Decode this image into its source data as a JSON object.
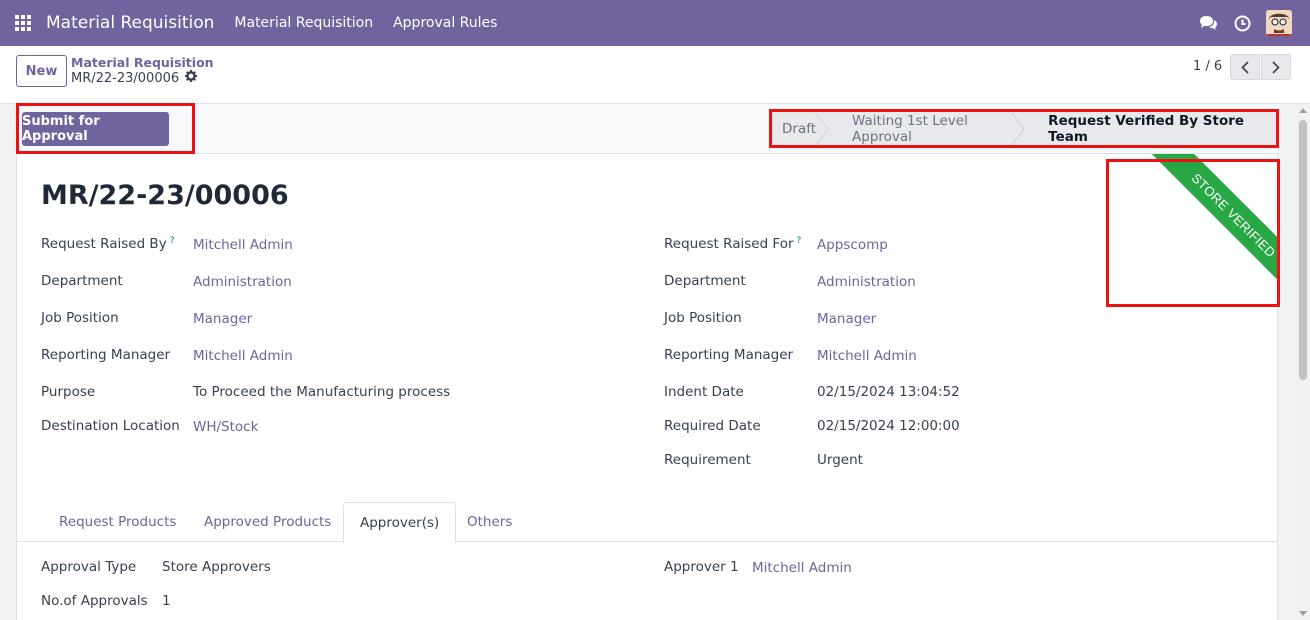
{
  "navbar": {
    "brand": "Material Requisition",
    "menu": [
      "Material Requisition",
      "Approval Rules"
    ]
  },
  "control": {
    "new_label": "New",
    "breadcrumb_parent": "Material Requisition",
    "breadcrumb_current": "MR/22-23/00006",
    "pager": "1 / 6"
  },
  "statusbar": {
    "submit_label": "Submit for Approval",
    "stages": [
      "Draft",
      "Waiting 1st Level Approval",
      "Request Verified By Store Team"
    ],
    "active_stage": "Request Verified By Store Team"
  },
  "ribbon": {
    "text": "STORE VERIFIED",
    "color": "#28a745"
  },
  "record": {
    "title": "MR/22-23/00006",
    "left": [
      {
        "label": "Request Raised By",
        "value": "Mitchell Admin",
        "help": "?"
      },
      {
        "label": "Department",
        "value": "Administration"
      },
      {
        "label": "Job Position",
        "value": "Manager"
      },
      {
        "label": "Reporting Manager",
        "value": "Mitchell Admin"
      },
      {
        "label": "Purpose",
        "value": "To Proceed the Manufacturing process"
      },
      {
        "label": "Destination Location",
        "value": "WH/Stock"
      }
    ],
    "right": [
      {
        "label": "Request Raised For",
        "value": "Appscomp",
        "help": "?"
      },
      {
        "label": "Department",
        "value": "Administration"
      },
      {
        "label": "Job Position",
        "value": "Manager"
      },
      {
        "label": "Reporting Manager",
        "value": "Mitchell Admin"
      },
      {
        "label": "Indent Date",
        "value": "02/15/2024 13:04:52"
      },
      {
        "label": "Required Date",
        "value": "02/15/2024 12:00:00"
      },
      {
        "label": "Requirement",
        "value": "Urgent"
      }
    ]
  },
  "tabs": [
    "Request Products",
    "Approved Products",
    "Approver(s)",
    "Others"
  ],
  "active_tab": "Approver(s)",
  "approvers": {
    "approval_type_label": "Approval Type",
    "approval_type": "Store Approvers",
    "count_label": "No.of Approvals",
    "count": "1",
    "approver1_label": "Approver 1",
    "approver1": "Mitchell Admin"
  },
  "colors": {
    "brand": "#71639e",
    "highlight": "#ee1111",
    "ribbon": "#28a745"
  }
}
